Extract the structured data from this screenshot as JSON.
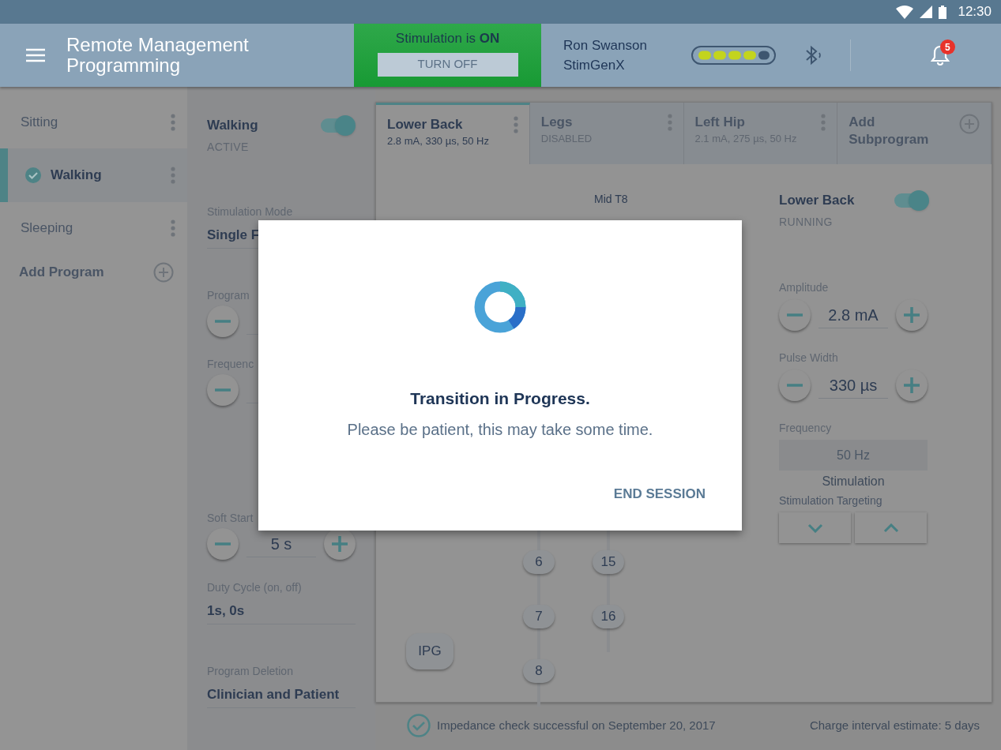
{
  "status_bar": {
    "time": "12:30"
  },
  "header": {
    "title": "Remote Management Programming",
    "stimulation": {
      "label": "Stimulation is **ON**",
      "on": true,
      "button": "TURN OFF"
    },
    "patient": {
      "name": "Ron Swanson",
      "device": "StimGenX"
    },
    "notifications": {
      "count": "5"
    }
  },
  "programs": [
    {
      "name": "Sitting",
      "selected": false,
      "active": false
    },
    {
      "name": "Walking",
      "selected": true,
      "active": true
    },
    {
      "name": "Sleeping",
      "selected": false,
      "active": false
    }
  ],
  "add_program": "Add Program",
  "program": {
    "name": "Walking",
    "on": true,
    "status": "ACTIVE",
    "fields": [
      {
        "kind": "select",
        "label": "Stimulation Mode",
        "value": "Single F"
      },
      {
        "kind": "stepper",
        "label": "Program"
      },
      {
        "kind": "stepper",
        "label": "Frequenc"
      },
      {
        "kind": "stepper",
        "label": "Soft Start",
        "value": "5 s"
      },
      {
        "kind": "select",
        "label": "Duty Cycle (on, off)",
        "value": "1s, 0s"
      },
      {
        "kind": "select",
        "label": "Program Deletion",
        "value": "Clinician and Patient"
      }
    ]
  },
  "tabs": [
    {
      "kind": "subprogram",
      "name": "Lower Back",
      "detail": "2.8 mA, 330 µs, 50 Hz",
      "selected": true
    },
    {
      "kind": "subprogram",
      "name": "Legs",
      "detail": "DISABLED",
      "selected": false
    },
    {
      "kind": "subprogram",
      "name": "Left Hip",
      "detail": "2.1 mA, 275 µs, 50 Hz",
      "selected": false
    },
    {
      "kind": "add",
      "name": "Add Subprogram",
      "selected": false
    }
  ],
  "leads": {
    "label": "Mid T8",
    "columns": [
      {
        "electrodes": [
          "6",
          "7",
          "8"
        ]
      },
      {
        "electrodes": [
          "15",
          "16"
        ]
      }
    ],
    "ipg": "IPG"
  },
  "subprogram": {
    "name": "Lower Back",
    "on": true,
    "status": "RUNNING",
    "amplitude": {
      "label": "Amplitude",
      "value": "2.8 mA"
    },
    "pulse_width": {
      "label": "Pulse Width",
      "value": "330 µs"
    },
    "frequency": {
      "label": "Frequency",
      "value": "50 Hz"
    },
    "stimulation": "Stimulation",
    "targeting": "Stimulation Targeting"
  },
  "footer": {
    "impedance": "Impedance check successful on September 20, 2017",
    "charge": "Charge interval estimate: 5 days"
  },
  "dialog": {
    "title": "Transition in Progress.",
    "message": "Please be patient, this may take some time.",
    "action": "END SESSION"
  }
}
